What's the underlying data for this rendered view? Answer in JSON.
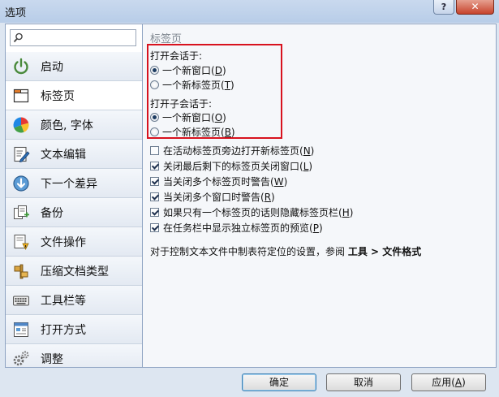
{
  "window": {
    "title": "选项",
    "help_label": "?",
    "close_label": "✕"
  },
  "search": {
    "value": "",
    "placeholder": ""
  },
  "sidebar": {
    "items": [
      {
        "label": "启动",
        "icon": "power-icon"
      },
      {
        "label": "标签页",
        "icon": "tab-page-icon",
        "selected": true
      },
      {
        "label": "颜色, 字体",
        "icon": "color-palette-icon"
      },
      {
        "label": "文本编辑",
        "icon": "text-edit-icon"
      },
      {
        "label": "下一个差异",
        "icon": "next-difference-icon"
      },
      {
        "label": "备份",
        "icon": "backup-icon"
      },
      {
        "label": "文件操作",
        "icon": "file-operations-icon"
      },
      {
        "label": "压缩文档类型",
        "icon": "archive-types-icon"
      },
      {
        "label": "工具栏等",
        "icon": "keyboard-icon"
      },
      {
        "label": "打开方式",
        "icon": "open-with-icon"
      },
      {
        "label": "调整",
        "icon": "gears-icon"
      }
    ]
  },
  "content": {
    "page_title": "标签页",
    "open_session": {
      "label": "打开会话于:",
      "options": [
        {
          "text": "一个新窗口(",
          "key": "D",
          "end": ")",
          "selected": true
        },
        {
          "text": "一个新标签页(",
          "key": "T",
          "end": ")",
          "selected": false
        }
      ]
    },
    "open_child_session": {
      "label": "打开子会话于:",
      "options": [
        {
          "text": "一个新窗口(",
          "key": "O",
          "end": ")",
          "selected": true
        },
        {
          "text": "一个新标签页(",
          "key": "B",
          "end": ")",
          "selected": false
        }
      ]
    },
    "checkboxes": [
      {
        "text": "在活动标签页旁边打开新标签页(",
        "key": "N",
        "end": ")",
        "checked": false
      },
      {
        "text": "关闭最后剩下的标签页关闭窗口(",
        "key": "L",
        "end": ")",
        "checked": true
      },
      {
        "text": "当关闭多个标签页时警告(",
        "key": "W",
        "end": ")",
        "checked": true
      },
      {
        "text": "当关闭多个窗口时警告(",
        "key": "R",
        "end": ")",
        "checked": true
      },
      {
        "text": "如果只有一个标签页的话则隐藏标签页栏(",
        "key": "H",
        "end": ")",
        "checked": true
      },
      {
        "text": "在任务栏中显示独立标签页的预览(",
        "key": "P",
        "end": ")",
        "checked": true
      }
    ],
    "info": {
      "prefix": "对于控制文本文件中制表符定位的设置，参阅 ",
      "bold": "工具 > 文件格式"
    }
  },
  "buttons": {
    "ok": "确定",
    "cancel": "取消",
    "apply_text": "应用(",
    "apply_key": "A",
    "apply_end": ")"
  },
  "colors": {
    "highlight_box": "#d8121e",
    "window_frame": "#dde6f1",
    "panel_border": "#8ea3c2"
  }
}
